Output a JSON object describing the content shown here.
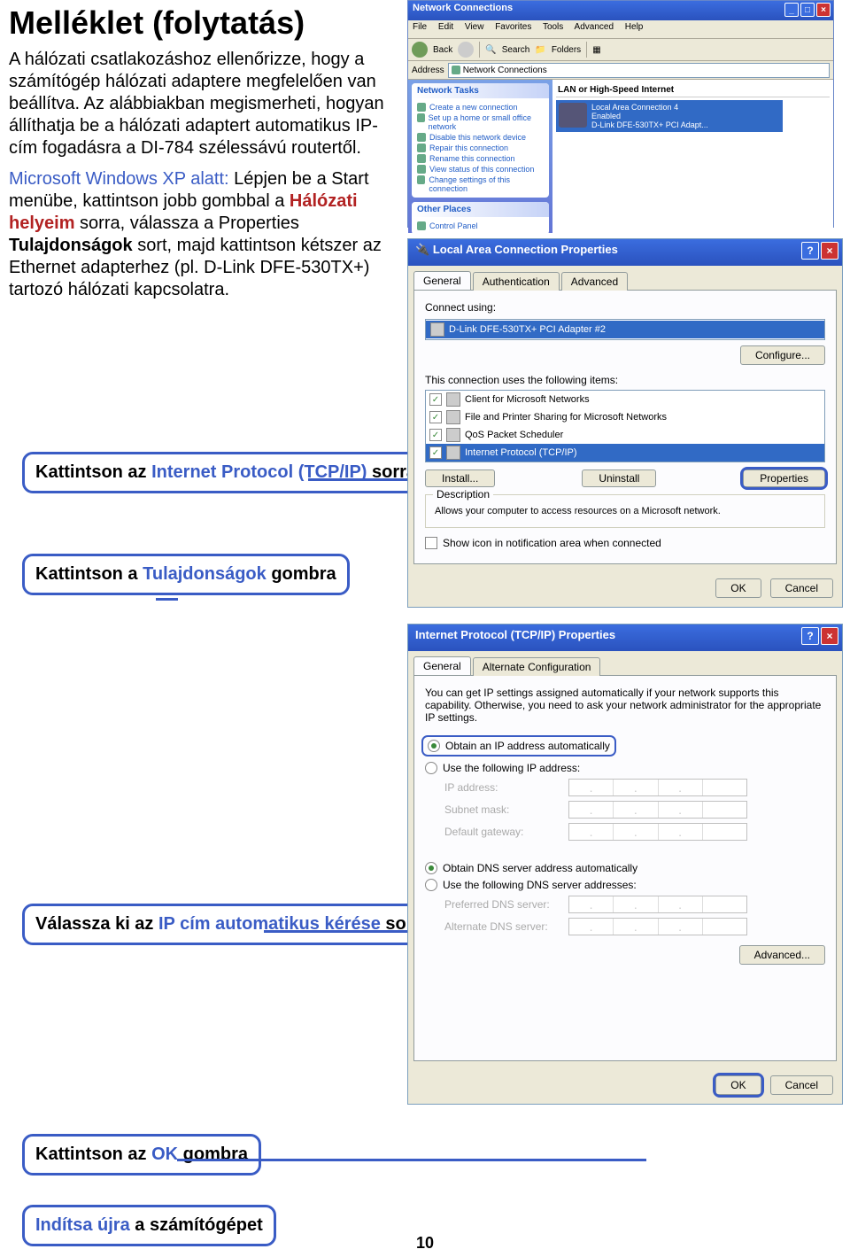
{
  "page_number": "10",
  "heading": "Melléklet (folytatás)",
  "intro_p1": "A hálózati csatlakozáshoz ellenőrizze, hogy a számítógép hálózati adaptere megfelelően van beállítva. Az alábbiakban megismerheti, hogyan állíthatja be a hálózati adaptert automatikus IP-cím fogadásra a DI-784 szélessávú routertől.",
  "intro_xp_lead": "Microsoft Windows XP alatt:",
  "intro_xp_rest": " Lépjen be a Start menübe, kattintson jobb gombbal a ",
  "intro_xp_red1": "Hálózati helyeim",
  "intro_xp_mid1": " sorra, válassza a Properties ",
  "intro_xp_bold1": "Tulajdonságok",
  "intro_xp_mid2": " sort, majd kattintson kétszer az Ethernet adapterhez (pl. D-Link DFE-530TX+) tartozó hálózati kapcsolatra.",
  "callout1_a": "Kattintson az ",
  "callout1_b": "Internet Protocol (TCP/IP)",
  "callout1_c": " sorra",
  "callout2_a": "Kattintson a ",
  "callout2_b": "Tulajdonságok",
  "callout2_c": " gombra",
  "callout3_a": "Válassza ki az ",
  "callout3_b": "IP cím automatikus kérése",
  "callout3_c": " sort",
  "callout4_a": "Kattintson az ",
  "callout4_b": "OK",
  "callout4_c": " gombra",
  "callout5_a": "Indítsa újra",
  "callout5_b": " a számítógépet",
  "netconn": {
    "title": "Network Connections",
    "menu": [
      "File",
      "Edit",
      "View",
      "Favorites",
      "Tools",
      "Advanced",
      "Help"
    ],
    "toolbar": {
      "back": "Back",
      "search": "Search",
      "folders": "Folders"
    },
    "address_label": "Address",
    "address_value": "Network Connections",
    "tasks_header": "Network Tasks",
    "tasks": [
      "Create a new connection",
      "Set up a home or small office network",
      "Disable this network device",
      "Repair this connection",
      "Rename this connection",
      "View status of this connection",
      "Change settings of this connection"
    ],
    "other_header": "Other Places",
    "other_items": [
      "Control Panel"
    ],
    "group": "LAN or High-Speed Internet",
    "item_name": "Local Area Connection 4",
    "item_state": "Enabled",
    "item_adapter": "D-Link DFE-530TX+ PCI Adapt..."
  },
  "lanprops": {
    "title": "Local Area Connection Properties",
    "tabs": [
      "General",
      "Authentication",
      "Advanced"
    ],
    "connect_using": "Connect using:",
    "adapter": "D-Link DFE-530TX+ PCI Adapter #2",
    "configure": "Configure...",
    "uses": "This connection uses the following items:",
    "items": [
      "Client for Microsoft Networks",
      "File and Printer Sharing for Microsoft Networks",
      "QoS Packet Scheduler",
      "Internet Protocol (TCP/IP)"
    ],
    "install": "Install...",
    "uninstall": "Uninstall",
    "properties": "Properties",
    "desc_label": "Description",
    "desc_text": "Allows your computer to access resources on a Microsoft network.",
    "show_icon": "Show icon in notification area when connected",
    "ok": "OK",
    "cancel": "Cancel"
  },
  "ipprops": {
    "title": "Internet Protocol (TCP/IP) Properties",
    "tabs": [
      "General",
      "Alternate Configuration"
    ],
    "intro": "You can get IP settings assigned automatically if your network supports this capability. Otherwise, you need to ask your network administrator for the appropriate IP settings.",
    "r_auto_ip": "Obtain an IP address automatically",
    "r_use_ip": "Use the following IP address:",
    "ip_address": "IP address:",
    "subnet": "Subnet mask:",
    "gateway": "Default gateway:",
    "r_auto_dns": "Obtain DNS server address automatically",
    "r_use_dns": "Use the following DNS server addresses:",
    "pref_dns": "Preferred DNS server:",
    "alt_dns": "Alternate DNS server:",
    "advanced": "Advanced...",
    "ok": "OK",
    "cancel": "Cancel"
  }
}
